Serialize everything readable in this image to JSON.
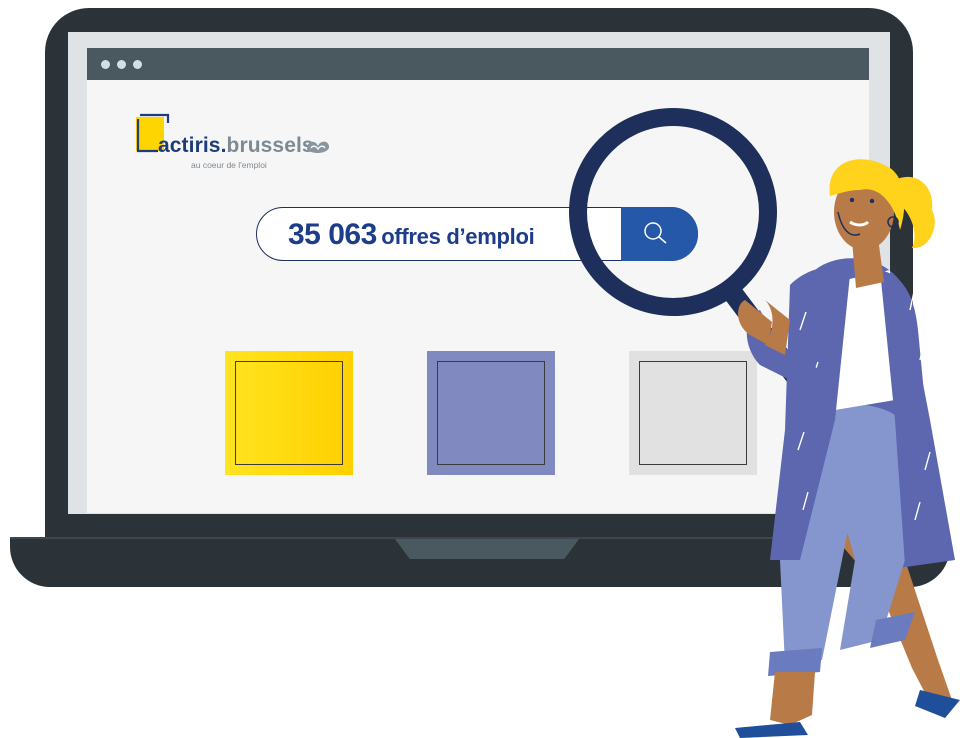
{
  "browser": {
    "window_dots": [
      "dot-1",
      "dot-2",
      "dot-3"
    ]
  },
  "logo": {
    "brand_primary": "actiris",
    "brand_dot": ".",
    "brand_secondary": "brussels",
    "tagline": "au coeur de l'emploi"
  },
  "search": {
    "count": "35 063",
    "label": "offres d’emploi",
    "button_icon": "search-icon"
  },
  "tiles": [
    {
      "name": "yellow-tile",
      "color": "#ffd500"
    },
    {
      "name": "violet-tile",
      "color": "#8089c0"
    },
    {
      "name": "grey-tile",
      "color": "#e1e1e1"
    }
  ],
  "colors": {
    "laptop": "#2b3338",
    "browser_bar": "#4a5860",
    "brand_blue": "#1d3c78",
    "search_button": "#2558a8",
    "magnifier": "#1d2f5a"
  }
}
